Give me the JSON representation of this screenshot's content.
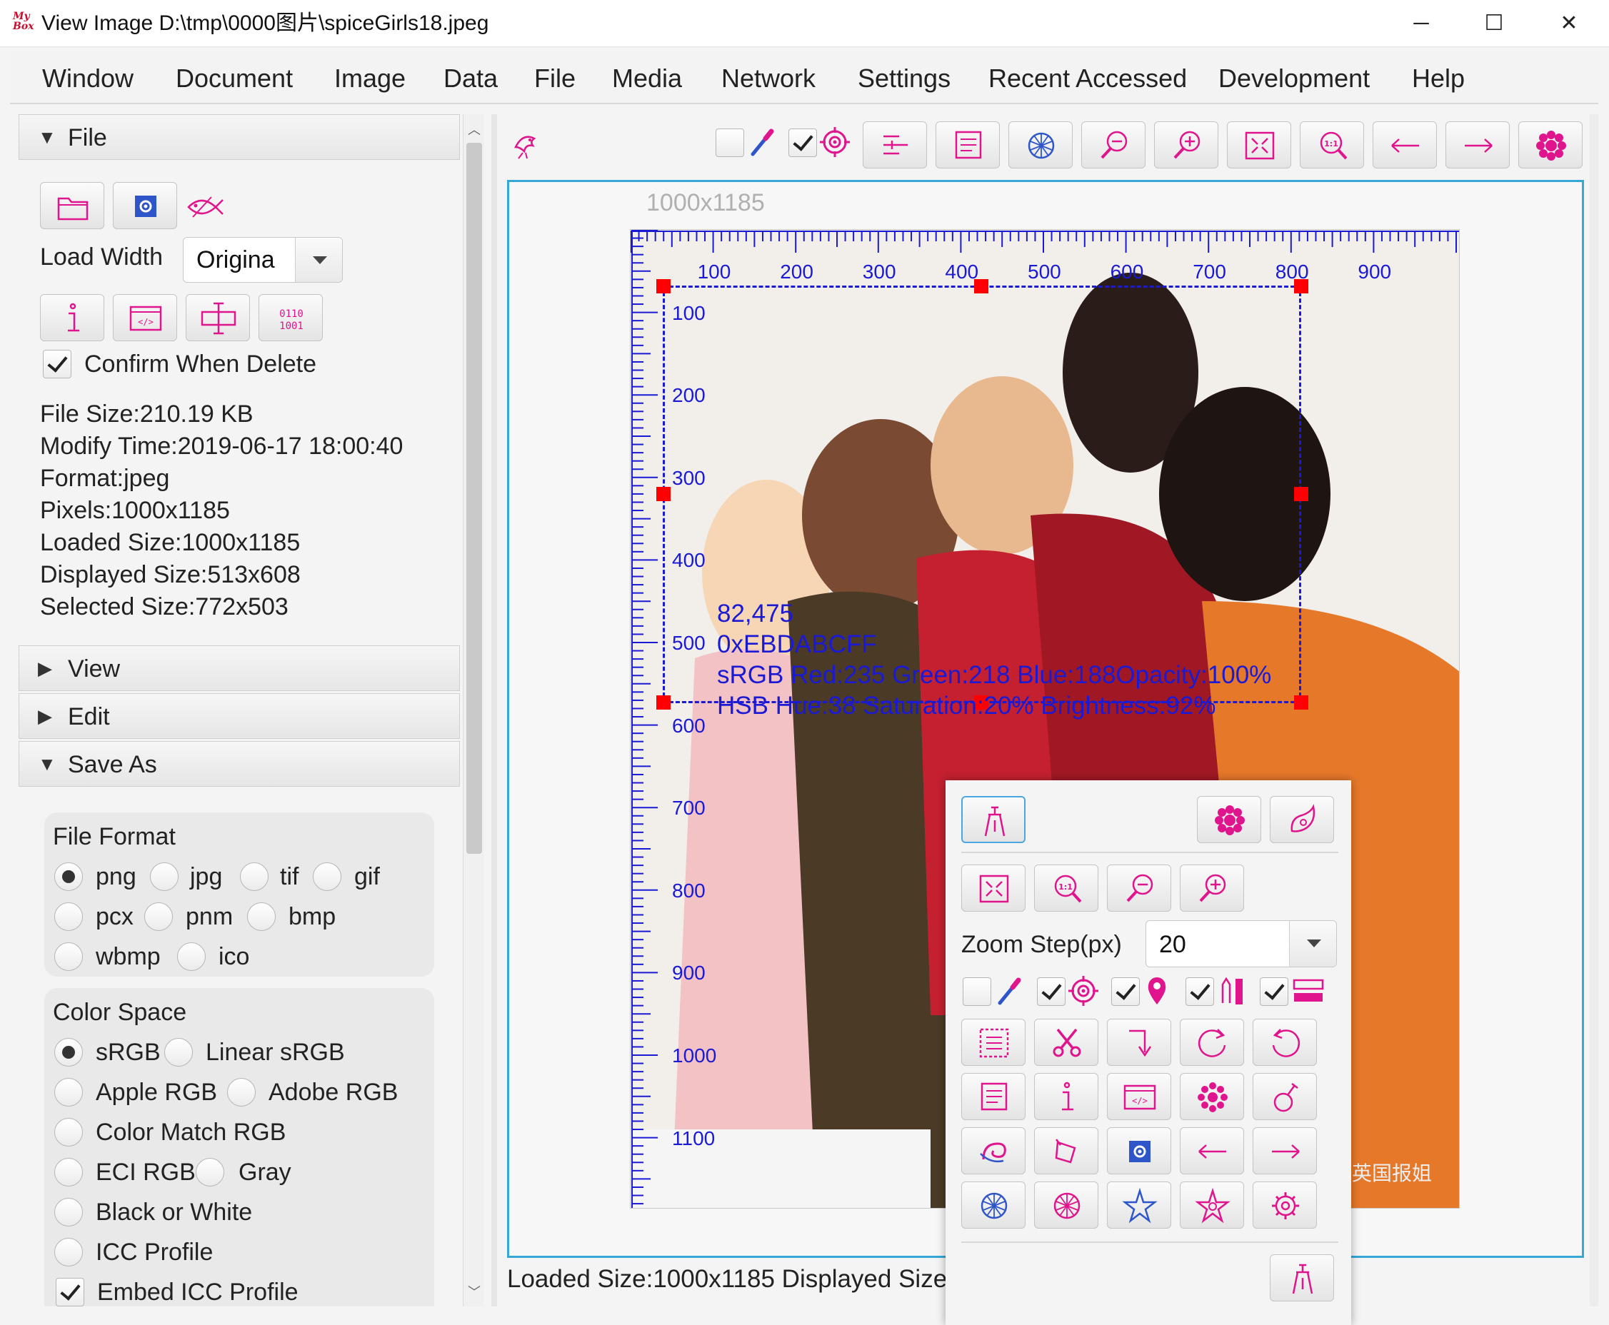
{
  "window": {
    "logo_text": "My Box",
    "title": "View Image D:\\tmp\\0000图片\\spiceGirls18.jpeg",
    "controls": [
      "─",
      "☐",
      "✕"
    ]
  },
  "menu": [
    "Window",
    "Document",
    "Image",
    "Data",
    "File",
    "Media",
    "Network",
    "Settings",
    "Recent Accessed",
    "Development",
    "Help"
  ],
  "left_panel": {
    "file_section": {
      "title": "File",
      "load_width_label": "Load Width",
      "load_width_value": "Origina",
      "confirm_delete_label": "Confirm When Delete",
      "confirm_delete_checked": true,
      "info": [
        "File Size:210.19 KB",
        "Modify Time:2019-06-17 18:00:40",
        "Format:jpeg",
        "Pixels:1000x1185",
        "Loaded Size:1000x1185",
        "Displayed Size:513x608",
        "Selected Size:772x503"
      ]
    },
    "view_section": {
      "title": "View"
    },
    "edit_section": {
      "title": "Edit"
    },
    "save_as_section": {
      "title": "Save As",
      "file_format": {
        "title": "File Format",
        "options": [
          "png",
          "jpg",
          "tif",
          "gif",
          "pcx",
          "pnm",
          "bmp",
          "wbmp",
          "ico"
        ],
        "selected": "png"
      },
      "color_space": {
        "title": "Color Space",
        "options": [
          "sRGB",
          "Linear sRGB",
          "Apple RGB",
          "Adobe RGB",
          "Color Match RGB",
          "ECI RGB",
          "Gray",
          "Black or White",
          "ICC Profile"
        ],
        "selected": "sRGB"
      },
      "embed_icc_label": "Embed ICC Profile",
      "embed_icc_checked": true
    }
  },
  "viewer": {
    "image_size_label": "1000x1185",
    "ruler_x": [
      "100",
      "200",
      "300",
      "400",
      "500",
      "600",
      "700",
      "800",
      "900"
    ],
    "ruler_y": [
      "100",
      "200",
      "300",
      "400",
      "500",
      "600",
      "700",
      "800",
      "900",
      "1000",
      "1100"
    ],
    "pick_info": {
      "coords": "82,475",
      "hex": "0xEBDABCFF",
      "srgb": "sRGB  Red:235 Green:218 Blue:188Opacity:100%",
      "hsb": "HSB  Hue:38 Saturation:20% Brightness:92%"
    },
    "watermark": "英国报姐",
    "toolbar": {
      "pick_color_checked": false,
      "select_area_checked": true
    }
  },
  "popup": {
    "zoom_step_label": "Zoom Step(px)",
    "zoom_step_value": "20",
    "toggles": [
      false,
      true,
      true,
      true,
      true
    ]
  },
  "status": {
    "text": "Loaded Size:1000x1185  Displayed Size"
  },
  "colors": {
    "accent": "#e0148c",
    "icon_blue": "#2f56c9",
    "ruler_blue": "#1a1ad4",
    "selection_handle": "#ff0000",
    "viewer_border": "#35a8d8"
  }
}
